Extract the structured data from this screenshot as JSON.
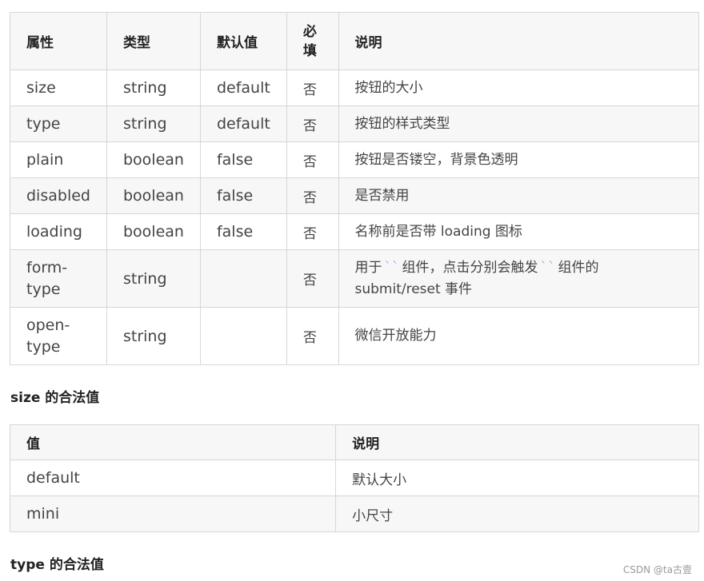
{
  "props_table": {
    "headers": [
      "属性",
      "类型",
      "默认值",
      "必填",
      "说明"
    ],
    "required_header_lines": [
      "必",
      "填"
    ],
    "rows": [
      {
        "name": "size",
        "type": "string",
        "default": "default",
        "required": "否",
        "desc": "按钮的大小"
      },
      {
        "name": "type",
        "type": "string",
        "default": "default",
        "required": "否",
        "desc": "按钮的样式类型"
      },
      {
        "name": "plain",
        "type": "boolean",
        "default": "false",
        "required": "否",
        "desc": "按钮是否镂空，背景色透明"
      },
      {
        "name": "disabled",
        "type": "boolean",
        "default": "false",
        "required": "否",
        "desc": "是否禁用"
      },
      {
        "name": "loading",
        "type": "boolean",
        "default": "false",
        "required": "否",
        "desc": "名称前是否带 loading 图标"
      },
      {
        "name_lines": [
          "form-",
          "type"
        ],
        "type": "string",
        "default": "",
        "required": "否",
        "desc_parts": [
          "用于",
          "``",
          "组件，点击分别会触发",
          "``",
          "组件的",
          "submit/reset 事件"
        ]
      },
      {
        "name_lines": [
          "open-",
          "type"
        ],
        "type": "string",
        "default": "",
        "required": "否",
        "desc": "微信开放能力"
      }
    ]
  },
  "size_section": {
    "title": "size 的合法值",
    "headers": [
      "值",
      "说明"
    ],
    "rows": [
      {
        "value": "default",
        "desc": "默认大小"
      },
      {
        "value": "mini",
        "desc": "小尺寸"
      }
    ]
  },
  "type_section": {
    "title": "type 的合法值"
  },
  "watermark": "CSDN @ta古壹",
  "colors": {
    "header_bg": "#f7f7f7",
    "border": "#d6d6d6",
    "tick": "#8ab4f8"
  }
}
